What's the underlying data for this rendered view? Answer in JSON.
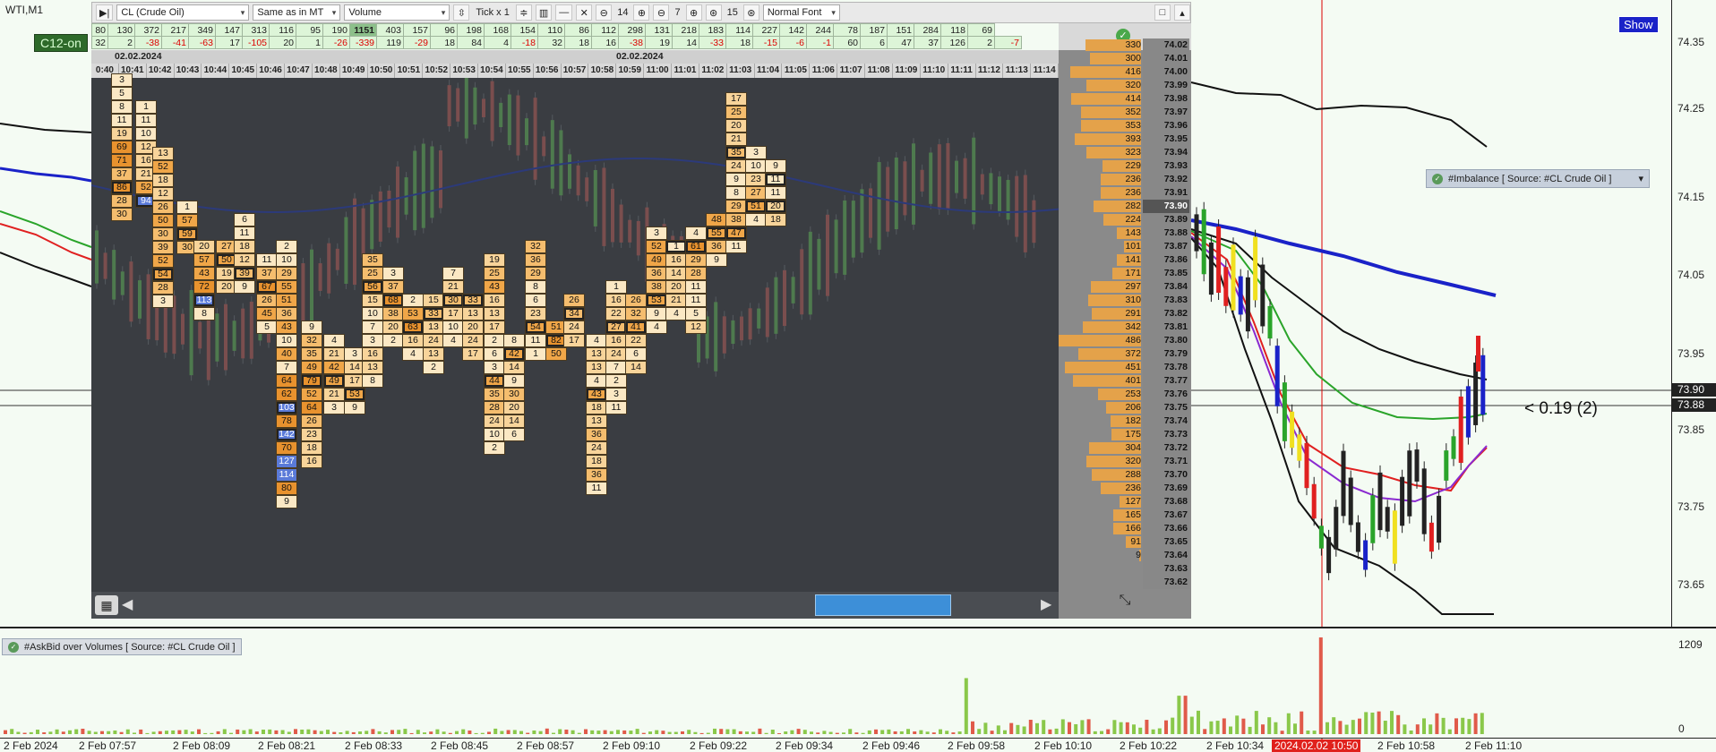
{
  "window": {
    "title": "WTI,M1",
    "show_button": "Show",
    "overlay_tag": "C12-on"
  },
  "toolbar": {
    "play_icon": "play-pause-icon",
    "symbol": "CL (Crude Oil)",
    "timeframe": "Same as in MT",
    "mode": "Volume",
    "tick": "Tick x 1",
    "step_a": "14",
    "step_b": "7",
    "step_c": "15",
    "font": "Normal Font"
  },
  "stats": {
    "row1": [
      "80",
      "130",
      "372",
      "217",
      "349",
      "147",
      "313",
      "116",
      "95",
      "190",
      "1151",
      "403",
      "157",
      "96",
      "198",
      "168",
      "154",
      "110",
      "86",
      "112",
      "298",
      "131",
      "218",
      "183",
      "114",
      "227",
      "142",
      "244",
      "78",
      "187",
      "151",
      "284",
      "118",
      "69"
    ],
    "row2": [
      "32",
      "2",
      "-38",
      "-41",
      "-63",
      "17",
      "-105",
      "20",
      "1",
      "-26",
      "-339",
      "119",
      "-29",
      "18",
      "84",
      "4",
      "-18",
      "32",
      "18",
      "16",
      "-38",
      "19",
      "14",
      "-33",
      "18",
      "-15",
      "-6",
      "-1",
      "60",
      "6",
      "47",
      "37",
      "126",
      "2",
      "-7"
    ]
  },
  "footprint": {
    "date_left": "02.02.2024",
    "date_right": "02.02.2024",
    "times": [
      "0:40",
      "10:41",
      "10:42",
      "10:43",
      "10:44",
      "10:45",
      "10:46",
      "10:47",
      "10:48",
      "10:49",
      "10:50",
      "10:51",
      "10:52",
      "10:53",
      "10:54",
      "10:55",
      "10:56",
      "10:57",
      "10:58",
      "10:59",
      "11:00",
      "11:01",
      "11:02",
      "11:03",
      "11:04",
      "11:05",
      "11:06",
      "11:07",
      "11:08",
      "11:09",
      "11:10",
      "11:11",
      "11:12",
      "11:13",
      "11:14"
    ]
  },
  "dom": {
    "levels": [
      {
        "vol": "300",
        "price": "74.01"
      },
      {
        "vol": "416",
        "price": "74.00"
      },
      {
        "vol": "320",
        "price": "73.99"
      },
      {
        "vol": "414",
        "price": "73.98"
      },
      {
        "vol": "352",
        "price": "73.97"
      },
      {
        "vol": "353",
        "price": "73.96"
      },
      {
        "vol": "393",
        "price": "73.95"
      },
      {
        "vol": "323",
        "price": "73.94"
      },
      {
        "vol": "229",
        "price": "73.93"
      },
      {
        "vol": "236",
        "price": "73.92"
      },
      {
        "vol": "236",
        "price": "73.91"
      },
      {
        "vol": "282",
        "price": "73.90"
      },
      {
        "vol": "224",
        "price": "73.89"
      },
      {
        "vol": "143",
        "price": "73.88"
      },
      {
        "vol": "101",
        "price": "73.87"
      },
      {
        "vol": "141",
        "price": "73.86"
      },
      {
        "vol": "171",
        "price": "73.85"
      },
      {
        "vol": "297",
        "price": "73.84"
      },
      {
        "vol": "310",
        "price": "73.83"
      },
      {
        "vol": "291",
        "price": "73.82"
      },
      {
        "vol": "342",
        "price": "73.81"
      },
      {
        "vol": "486",
        "price": "73.80"
      },
      {
        "vol": "372",
        "price": "73.79"
      },
      {
        "vol": "451",
        "price": "73.78"
      },
      {
        "vol": "401",
        "price": "73.77"
      },
      {
        "vol": "253",
        "price": "73.76"
      },
      {
        "vol": "206",
        "price": "73.75"
      },
      {
        "vol": "182",
        "price": "73.74"
      },
      {
        "vol": "175",
        "price": "73.73"
      },
      {
        "vol": "304",
        "price": "73.72"
      },
      {
        "vol": "320",
        "price": "73.71"
      },
      {
        "vol": "288",
        "price": "73.70"
      },
      {
        "vol": "236",
        "price": "73.69"
      },
      {
        "vol": "127",
        "price": "73.68"
      },
      {
        "vol": "165",
        "price": "73.67"
      },
      {
        "vol": "166",
        "price": "73.66"
      },
      {
        "vol": "91",
        "price": "73.65"
      },
      {
        "vol": "9",
        "price": "73.64"
      },
      {
        "vol": "",
        "price": "73.63"
      },
      {
        "vol": "",
        "price": "73.62"
      }
    ],
    "top_partial": {
      "vol": "330",
      "price": "74.02"
    },
    "current_price": "73.90"
  },
  "price_axis": {
    "labels": [
      "74.35",
      "74.25",
      "74.15",
      "74.05",
      "73.95",
      "73.85",
      "73.75",
      "73.65"
    ],
    "tag_bid": "73.90",
    "tag_ask": "73.88"
  },
  "indicators": {
    "imbalance_legend": "#Imbalance [ Source: #CL Crude Oil ]",
    "askbid_legend": "#AskBid over Volumes [ Source: #CL Crude Oil ]",
    "distance_label": "< 0.19 (2)",
    "sub_axis_max": "1209",
    "sub_axis_min": "0"
  },
  "time_axis": {
    "labels": [
      "2 Feb 2024",
      "2 Feb 07:57",
      "2 Feb 08:09",
      "2 Feb 08:21",
      "2 Feb 08:33",
      "2 Feb 08:45",
      "2 Feb 08:57",
      "2 Feb 09:10",
      "2 Feb 09:22",
      "2 Feb 09:34",
      "2 Feb 09:46",
      "2 Feb 09:58",
      "2 Feb 10:10",
      "2 Feb 10:22",
      "2 Feb 10:34",
      "2024.02.02 10:50",
      "2 Feb 10:58",
      "2 Feb 11:10"
    ],
    "highlight": "2024.02.02 10:50"
  },
  "chart_data": {
    "type": "candlestick",
    "symbol": "WTI",
    "timeframe": "M1",
    "ylim": [
      73.62,
      74.37
    ],
    "footprint_columns": [
      {
        "time": "10:41",
        "cells": [
          [
            "74.02",
            "3"
          ],
          [
            "74.01",
            "5"
          ],
          [
            "74.00",
            "8"
          ],
          [
            "73.99",
            "11"
          ],
          [
            "73.98",
            "19"
          ],
          [
            "73.97",
            "69"
          ],
          [
            "73.96",
            "71"
          ],
          [
            "73.95",
            "37"
          ],
          [
            "73.94",
            "86"
          ],
          [
            "73.93",
            "28"
          ],
          [
            "73.92",
            "30"
          ]
        ]
      },
      {
        "time": "10:42",
        "cells": [
          [
            "73.98",
            "1"
          ],
          [
            "73.97",
            "11"
          ],
          [
            "73.96",
            "10"
          ],
          [
            "73.95",
            "12"
          ],
          [
            "73.94",
            "16"
          ],
          [
            "73.93",
            "21"
          ],
          [
            "73.92",
            "52"
          ],
          [
            "73.91",
            "94"
          ]
        ]
      },
      {
        "time": "10:43",
        "cells": [
          [
            "73.94",
            "13"
          ],
          [
            "73.93",
            "52"
          ],
          [
            "73.92",
            "18"
          ],
          [
            "73.91",
            "12"
          ],
          [
            "73.90",
            "26"
          ],
          [
            "73.89",
            "50"
          ],
          [
            "73.88",
            "30"
          ],
          [
            "73.87",
            "39"
          ],
          [
            "73.86",
            "52"
          ],
          [
            "73.85",
            "54"
          ],
          [
            "73.84",
            "28"
          ],
          [
            "73.83",
            "3"
          ]
        ]
      },
      {
        "time": "10:44",
        "cells": [
          [
            "73.89",
            "1"
          ],
          [
            "73.88",
            "57"
          ],
          [
            "73.87",
            "59"
          ],
          [
            "73.86",
            "30"
          ]
        ]
      },
      {
        "time": "10:45",
        "cells": [
          [
            "73.86",
            "20"
          ],
          [
            "73.85",
            "57"
          ],
          [
            "73.84",
            "43"
          ],
          [
            "73.83",
            "72"
          ],
          [
            "73.82",
            "113"
          ],
          [
            "73.81",
            "8"
          ]
        ]
      },
      {
        "time": "10:46",
        "cells": [
          [
            "73.86",
            "27"
          ],
          [
            "73.85",
            "50"
          ],
          [
            "73.84",
            "19"
          ],
          [
            "73.83",
            "20"
          ]
        ]
      },
      {
        "time": "10:47",
        "cells": [
          [
            "73.88",
            "6"
          ],
          [
            "73.87",
            "11"
          ],
          [
            "73.86",
            "18"
          ],
          [
            "73.85",
            "12"
          ],
          [
            "73.84",
            "39"
          ],
          [
            "73.83",
            "9"
          ]
        ]
      },
      {
        "time": "10:48",
        "cells": [
          [
            "73.84",
            "11"
          ],
          [
            "73.83",
            "37"
          ],
          [
            "73.82",
            "67"
          ],
          [
            "73.81",
            "26"
          ],
          [
            "73.80",
            "45"
          ],
          [
            "73.79",
            "5"
          ]
        ]
      },
      {
        "time": "10:49",
        "cells": [
          [
            "73.84",
            "2"
          ],
          [
            "73.83",
            "10"
          ],
          [
            "73.82",
            "29"
          ],
          [
            "73.81",
            "55"
          ],
          [
            "73.80",
            "51"
          ],
          [
            "73.79",
            "36"
          ],
          [
            "73.78",
            "43"
          ],
          [
            "73.77",
            "10"
          ],
          [
            "73.76",
            "40"
          ],
          [
            "73.75",
            "7"
          ],
          [
            "73.74",
            "64"
          ],
          [
            "73.73",
            "62"
          ],
          [
            "73.72",
            "103"
          ],
          [
            "73.71",
            "78"
          ],
          [
            "73.70",
            "142"
          ],
          [
            "73.69",
            "70"
          ],
          [
            "73.68",
            "127"
          ],
          [
            "73.67",
            "114"
          ],
          [
            "73.66",
            "80"
          ],
          [
            "73.65",
            "9"
          ]
        ]
      },
      {
        "time": "10:50",
        "cells": [
          [
            "73.77",
            "9"
          ],
          [
            "73.76",
            "32"
          ],
          [
            "73.75",
            "35"
          ],
          [
            "73.74",
            "49"
          ],
          [
            "73.73",
            "79"
          ],
          [
            "73.72",
            "52"
          ],
          [
            "73.71",
            "64"
          ],
          [
            "73.70",
            "26"
          ],
          [
            "73.69",
            "23"
          ],
          [
            "73.68",
            "18"
          ],
          [
            "73.67",
            "16"
          ]
        ]
      }
    ],
    "askbid_volume_max": 1209
  }
}
